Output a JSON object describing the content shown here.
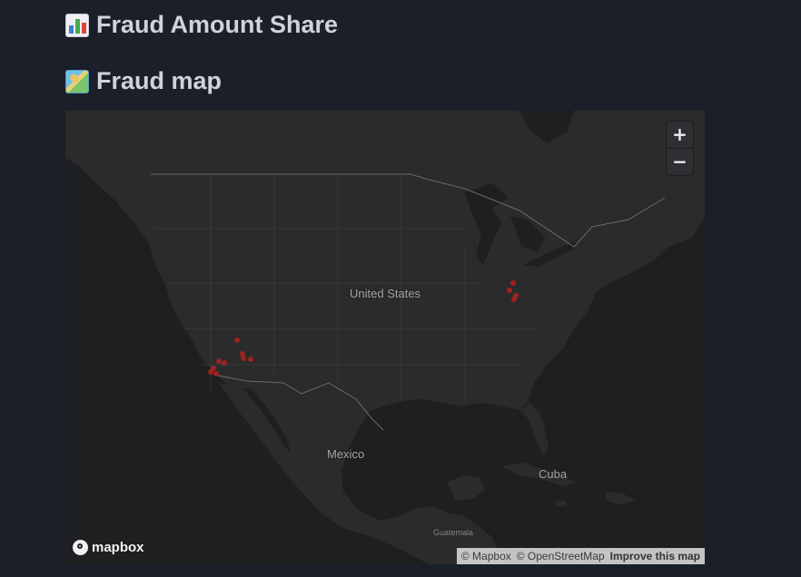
{
  "headings": {
    "amount_share": {
      "icon": "bar-chart-emoji-icon",
      "text": "Fraud Amount Share"
    },
    "fraud_map": {
      "icon": "world-map-emoji-icon",
      "text": "Fraud map"
    }
  },
  "map": {
    "labels": {
      "united_states": "United States",
      "mexico": "Mexico",
      "cuba": "Cuba",
      "guatemala": "Guatemala"
    },
    "controls": {
      "zoom_in": "+",
      "zoom_out": "−"
    },
    "logo_text": "mapbox",
    "attribution": {
      "mapbox": "© Mapbox",
      "osm": "© OpenStreetMap",
      "improve": "Improve this map"
    },
    "marker_color": "#b22222",
    "land_color": "#2b2b2b",
    "water_color": "#1e1f21"
  }
}
